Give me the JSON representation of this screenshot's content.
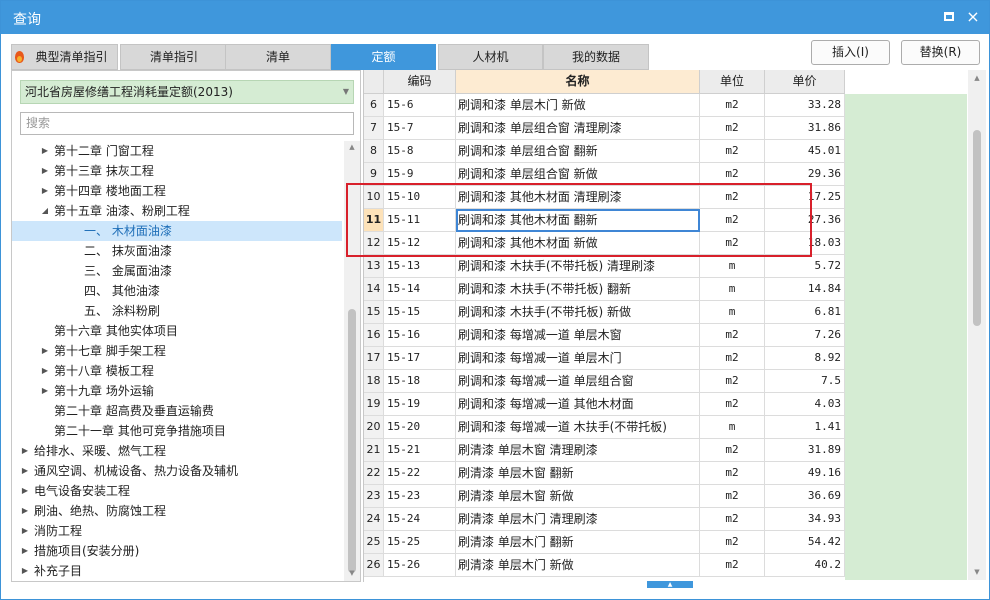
{
  "window": {
    "title": "查询",
    "maximize_icon": "maximize-icon",
    "close_icon": "close-icon",
    "close_glyph": "×"
  },
  "tabs": [
    {
      "label": "典型清单指引",
      "icon": "fire-icon",
      "active": false
    },
    {
      "label": "清单指引",
      "active": false
    },
    {
      "label": "清单",
      "active": false
    },
    {
      "label": "定额",
      "active": true
    },
    {
      "label": "人材机",
      "active": false
    },
    {
      "label": "我的数据",
      "active": false
    }
  ],
  "actions": {
    "insert_label": "插入(I)",
    "replace_label": "替换(R)"
  },
  "left": {
    "library": "河北省房屋修缮工程消耗量定额(2013)",
    "search_placeholder": "搜索",
    "tree": [
      {
        "label": "第十二章 门窗工程",
        "level": 1,
        "arrow": "▶",
        "selected": false
      },
      {
        "label": "第十三章 抹灰工程",
        "level": 1,
        "arrow": "▶",
        "selected": false
      },
      {
        "label": "第十四章 楼地面工程",
        "level": 1,
        "arrow": "▶",
        "selected": false
      },
      {
        "label": "第十五章 油漆、粉刷工程",
        "level": 1,
        "arrow": "◢",
        "selected": false
      },
      {
        "label": "一、 木材面油漆",
        "level": 2,
        "arrow": "",
        "selected": true
      },
      {
        "label": "二、 抹灰面油漆",
        "level": 2,
        "arrow": "",
        "selected": false
      },
      {
        "label": "三、 金属面油漆",
        "level": 2,
        "arrow": "",
        "selected": false
      },
      {
        "label": "四、 其他油漆",
        "level": 2,
        "arrow": "",
        "selected": false
      },
      {
        "label": "五、 涂料粉刷",
        "level": 2,
        "arrow": "",
        "selected": false
      },
      {
        "label": "第十六章 其他实体项目",
        "level": 1,
        "arrow": "",
        "selected": false
      },
      {
        "label": "第十七章 脚手架工程",
        "level": 1,
        "arrow": "▶",
        "selected": false
      },
      {
        "label": "第十八章 模板工程",
        "level": 1,
        "arrow": "▶",
        "selected": false
      },
      {
        "label": "第十九章 场外运输",
        "level": 1,
        "arrow": "▶",
        "selected": false
      },
      {
        "label": "第二十章 超高费及垂直运输费",
        "level": 1,
        "arrow": "",
        "selected": false
      },
      {
        "label": "第二十一章 其他可竞争措施项目",
        "level": 1,
        "arrow": "",
        "selected": false
      },
      {
        "label": "给排水、采暖、燃气工程",
        "level": 0,
        "arrow": "▶",
        "selected": false
      },
      {
        "label": "通风空调、机械设备、热力设备及辅机",
        "level": 0,
        "arrow": "▶",
        "selected": false
      },
      {
        "label": "电气设备安装工程",
        "level": 0,
        "arrow": "▶",
        "selected": false
      },
      {
        "label": "刷油、绝热、防腐蚀工程",
        "level": 0,
        "arrow": "▶",
        "selected": false
      },
      {
        "label": "消防工程",
        "level": 0,
        "arrow": "▶",
        "selected": false
      },
      {
        "label": "措施项目(安装分册)",
        "level": 0,
        "arrow": "▶",
        "selected": false
      },
      {
        "label": "补充子目",
        "level": 0,
        "arrow": "▶",
        "selected": false
      }
    ]
  },
  "grid": {
    "headers": {
      "code": "编码",
      "name": "名称",
      "unit": "单位",
      "price": "单价"
    },
    "current_row": "11",
    "rows": [
      {
        "num": "6",
        "code": "15-6",
        "name": "刷调和漆 单层木门 新做",
        "unit": "m2",
        "price": "33.28"
      },
      {
        "num": "7",
        "code": "15-7",
        "name": "刷调和漆 单层组合窗 清理刷漆",
        "unit": "m2",
        "price": "31.86"
      },
      {
        "num": "8",
        "code": "15-8",
        "name": "刷调和漆 单层组合窗 翻新",
        "unit": "m2",
        "price": "45.01"
      },
      {
        "num": "9",
        "code": "15-9",
        "name": "刷调和漆 单层组合窗 新做",
        "unit": "m2",
        "price": "29.36"
      },
      {
        "num": "10",
        "code": "15-10",
        "name": "刷调和漆 其他木材面 清理刷漆",
        "unit": "m2",
        "price": "17.25"
      },
      {
        "num": "11",
        "code": "15-11",
        "name": "刷调和漆 其他木材面 翻新",
        "unit": "m2",
        "price": "27.36"
      },
      {
        "num": "12",
        "code": "15-12",
        "name": "刷调和漆 其他木材面 新做",
        "unit": "m2",
        "price": "18.03"
      },
      {
        "num": "13",
        "code": "15-13",
        "name": "刷调和漆 木扶手(不带托板) 清理刷漆",
        "unit": "m",
        "price": "5.72"
      },
      {
        "num": "14",
        "code": "15-14",
        "name": "刷调和漆 木扶手(不带托板) 翻新",
        "unit": "m",
        "price": "14.84"
      },
      {
        "num": "15",
        "code": "15-15",
        "name": "刷调和漆 木扶手(不带托板) 新做",
        "unit": "m",
        "price": "6.81"
      },
      {
        "num": "16",
        "code": "15-16",
        "name": "刷调和漆 每增减一道 单层木窗",
        "unit": "m2",
        "price": "7.26"
      },
      {
        "num": "17",
        "code": "15-17",
        "name": "刷调和漆 每增减一道 单层木门",
        "unit": "m2",
        "price": "8.92"
      },
      {
        "num": "18",
        "code": "15-18",
        "name": "刷调和漆 每增减一道 单层组合窗",
        "unit": "m2",
        "price": "7.5"
      },
      {
        "num": "19",
        "code": "15-19",
        "name": "刷调和漆 每增减一道 其他木材面",
        "unit": "m2",
        "price": "4.03"
      },
      {
        "num": "20",
        "code": "15-20",
        "name": "刷调和漆 每增减一道 木扶手(不带托板)",
        "unit": "m",
        "price": "1.41"
      },
      {
        "num": "21",
        "code": "15-21",
        "name": "刷清漆 单层木窗 清理刷漆",
        "unit": "m2",
        "price": "31.89"
      },
      {
        "num": "22",
        "code": "15-22",
        "name": "刷清漆 单层木窗 翻新",
        "unit": "m2",
        "price": "49.16"
      },
      {
        "num": "23",
        "code": "15-23",
        "name": "刷清漆 单层木窗 新做",
        "unit": "m2",
        "price": "36.69"
      },
      {
        "num": "24",
        "code": "15-24",
        "name": "刷清漆 单层木门 清理刷漆",
        "unit": "m2",
        "price": "34.93"
      },
      {
        "num": "25",
        "code": "15-25",
        "name": "刷清漆 单层木门 翻新",
        "unit": "m2",
        "price": "54.42"
      },
      {
        "num": "26",
        "code": "15-26",
        "name": "刷清漆 单层木门 新做",
        "unit": "m2",
        "price": "40.2"
      }
    ]
  },
  "colors": {
    "accent": "#3f97dc",
    "highlight_border": "#d8202b",
    "green_fill": "#d5ecd3"
  }
}
